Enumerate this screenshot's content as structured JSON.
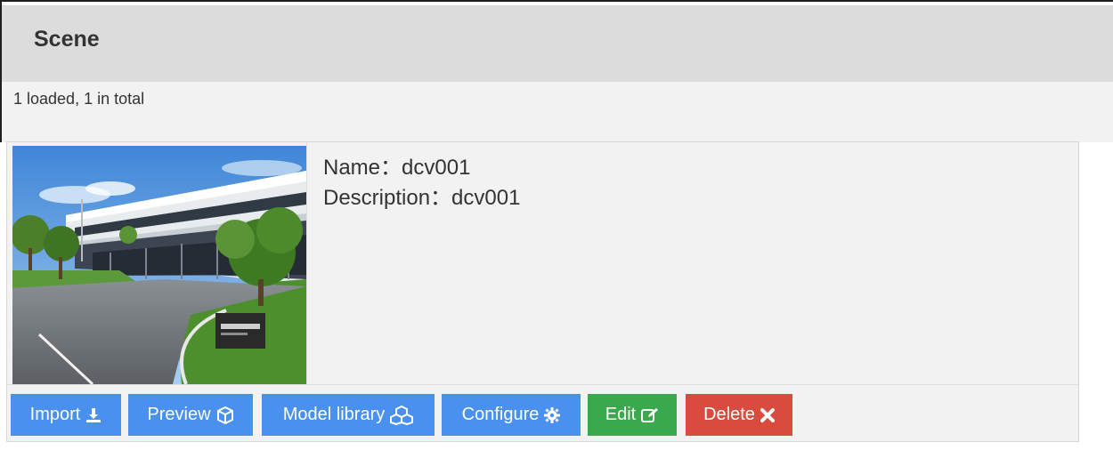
{
  "header": {
    "title": "Scene"
  },
  "summary": {
    "count_text": "1 loaded, 1 in total"
  },
  "scene": {
    "name_label": "Name：",
    "name_value": "dcv001",
    "description_label": "Description：",
    "description_value": "dcv001",
    "thumbnail_alt": "scene-thumbnail"
  },
  "actions": {
    "import": {
      "label": "Import",
      "icon": "download-icon"
    },
    "preview": {
      "label": "Preview",
      "icon": "cube-icon"
    },
    "model_library": {
      "label": "Model library",
      "icon": "cubes-icon"
    },
    "configure": {
      "label": "Configure",
      "icon": "gear-icon"
    },
    "edit": {
      "label": "Edit",
      "icon": "edit-icon"
    },
    "delete": {
      "label": "Delete",
      "icon": "close-icon"
    }
  },
  "colors": {
    "primary": "#4a90ee",
    "success": "#3aa84c",
    "danger": "#d94b3f",
    "header_bg": "#dcdcdc"
  }
}
